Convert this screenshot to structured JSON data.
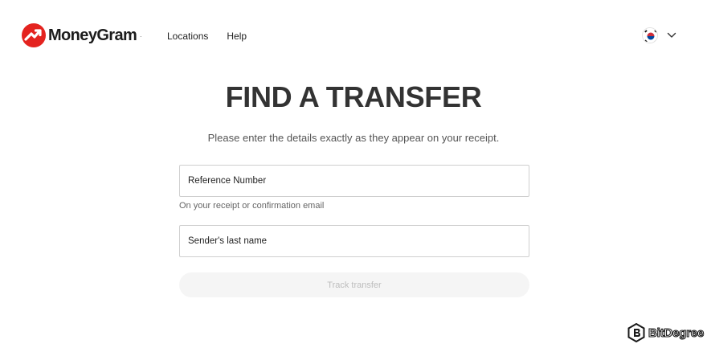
{
  "brand": {
    "name": "MoneyGram",
    "reg_mark": ".",
    "accent_color": "#e4231f"
  },
  "nav": {
    "items": [
      {
        "label": "Locations"
      },
      {
        "label": "Help"
      }
    ]
  },
  "language": {
    "flag_icon": "korea-flag-icon",
    "chevron_icon": "chevron-down-icon"
  },
  "main": {
    "title": "FIND A TRANSFER",
    "subtitle": "Please enter the details exactly as they appear on your receipt.",
    "reference_field": {
      "label": "Reference Number",
      "hint": "On your receipt or confirmation email"
    },
    "name_field": {
      "label": "Sender's last name"
    },
    "track_button": "Track transfer"
  },
  "watermark": {
    "text": "BitDegree"
  }
}
